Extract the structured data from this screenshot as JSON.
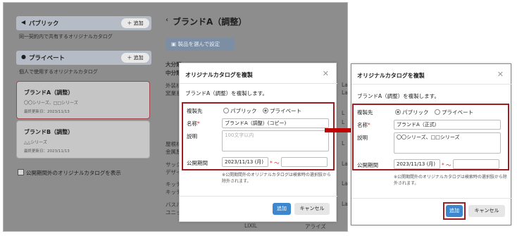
{
  "left": {
    "public": {
      "title": "パブリック",
      "add": "追加",
      "desc": "同一契約内で共有するオリジナルカタログ"
    },
    "private": {
      "title": "プライベート",
      "add": "追加",
      "desc": "個人で使用するオリジナルカタログ"
    },
    "cards": [
      {
        "title": "ブランドA（調整）",
        "sub": "〇〇シリーズ、□□シリーズ",
        "date": "最終更新日：2023/11/13"
      },
      {
        "title": "ブランドB（調整）",
        "sub": "△△シリーズ",
        "date": "最終更新日：2023/11/13"
      }
    ],
    "show_expired": "公開期間外のオリジナルカタログを表示",
    "main_title": "ブランドA（調整）",
    "pick_button": "製品を選んで設定",
    "bg_texts": [
      "大分類",
      "中分類",
      "外装材",
      "窯業系",
      "屋根材",
      "金属屋",
      "サッシ",
      "デザイ",
      "キッチ",
      "キッチ",
      "バスル",
      "ユニッ",
      "LIXIL",
      "アライズ",
      "La",
      "La",
      "L",
      "L",
      "L",
      "La",
      "La",
      "La"
    ]
  },
  "modal1": {
    "title": "オリジナルカタログを複製",
    "message": "ブランドA（調整）を複製します。",
    "dest_label": "複製先",
    "public_opt": "パブリック",
    "private_opt": "プライベート",
    "name_label": "名称",
    "req": "*",
    "name_value": "ブランドA（調整）(コピー)",
    "desc_label": "説明",
    "desc_placeholder": "100文字以内",
    "period_label": "公開期間",
    "period_start": "2023/11/13 (月)",
    "period_sep": "* ～",
    "note": "※公開期間外のオリジナルカタログは検索時の選択肢から除外されます。",
    "add": "追加",
    "cancel": "キャンセル"
  },
  "modal2": {
    "title": "オリジナルカタログを複製",
    "message": "ブランドA（調整）を複製します。",
    "dest_label": "複製先",
    "public_opt": "パブリック",
    "private_opt": "プライベート",
    "name_label": "名称",
    "req": "*",
    "name_value": "ブランドA（正式）",
    "desc_label": "説明",
    "desc_value": "〇〇シリーズ、□□シリーズ",
    "period_label": "公開期間",
    "period_start": "2023/11/13 (月)",
    "period_sep": "* ～",
    "note": "※公開期間外のオリジナルカタログは検索時の選択肢から除外されます。",
    "add": "追加",
    "cancel": "キャンセル"
  },
  "colors": {
    "highlight": "#a01d24",
    "primary": "#3d87cf",
    "arrow": "#c00000"
  }
}
